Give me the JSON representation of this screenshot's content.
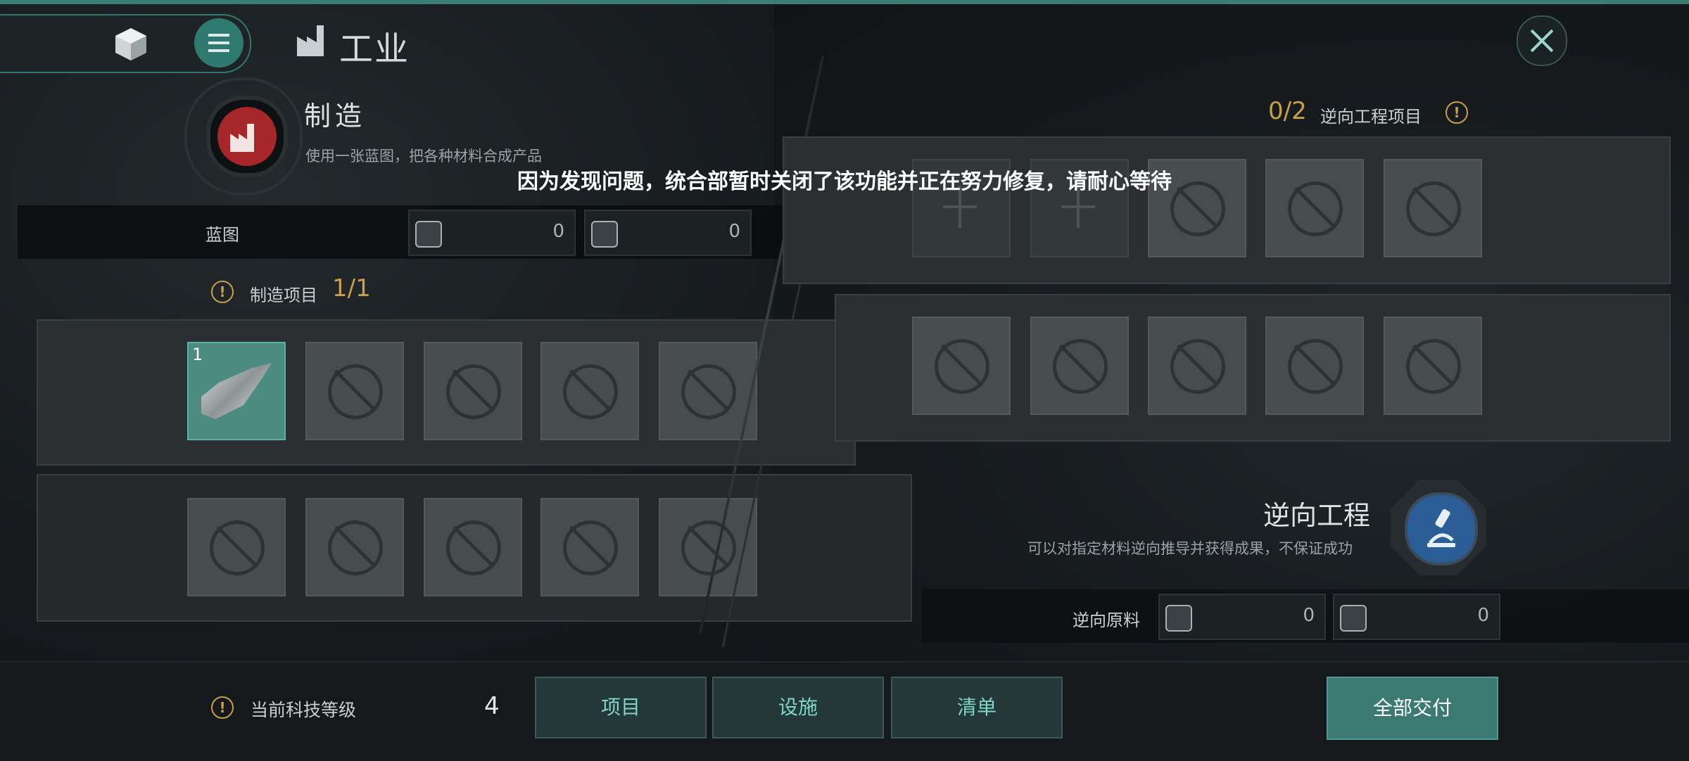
{
  "nav": {
    "title": "工业",
    "cube_icon": "cube-icon",
    "menu_icon": "menu-icon",
    "close_icon": "close-icon"
  },
  "manufacture": {
    "title": "制造",
    "description": "使用一张蓝图，把各种材料合成产品",
    "icon": "factory-icon",
    "accent": "#a7262a"
  },
  "notice": "因为发现问题，统合部暂时关闭了该功能并正在努力修复，请耐心等待",
  "blueprint": {
    "label": "蓝图",
    "res1": "0",
    "res2": "0"
  },
  "manufacture_projects": {
    "label": "制造项目",
    "count": "1/1",
    "filled_slot_number": "1"
  },
  "reverse": {
    "count": "0/2",
    "label": "逆向工程项目",
    "title": "逆向工程",
    "description": "可以对指定材料逆向推导并获得成果，不保证成功",
    "icon": "microscope-icon",
    "accent": "#2b5d96",
    "materials_label": "逆向原料",
    "res1": "0",
    "res2": "0"
  },
  "bottom": {
    "tech_label": "当前科技等级",
    "tech_value": "4",
    "buttons": [
      "项目",
      "设施",
      "清单"
    ],
    "deliver_all": "全部交付"
  },
  "colors": {
    "teal": "#3a7a72",
    "gold": "#c9a04a"
  }
}
